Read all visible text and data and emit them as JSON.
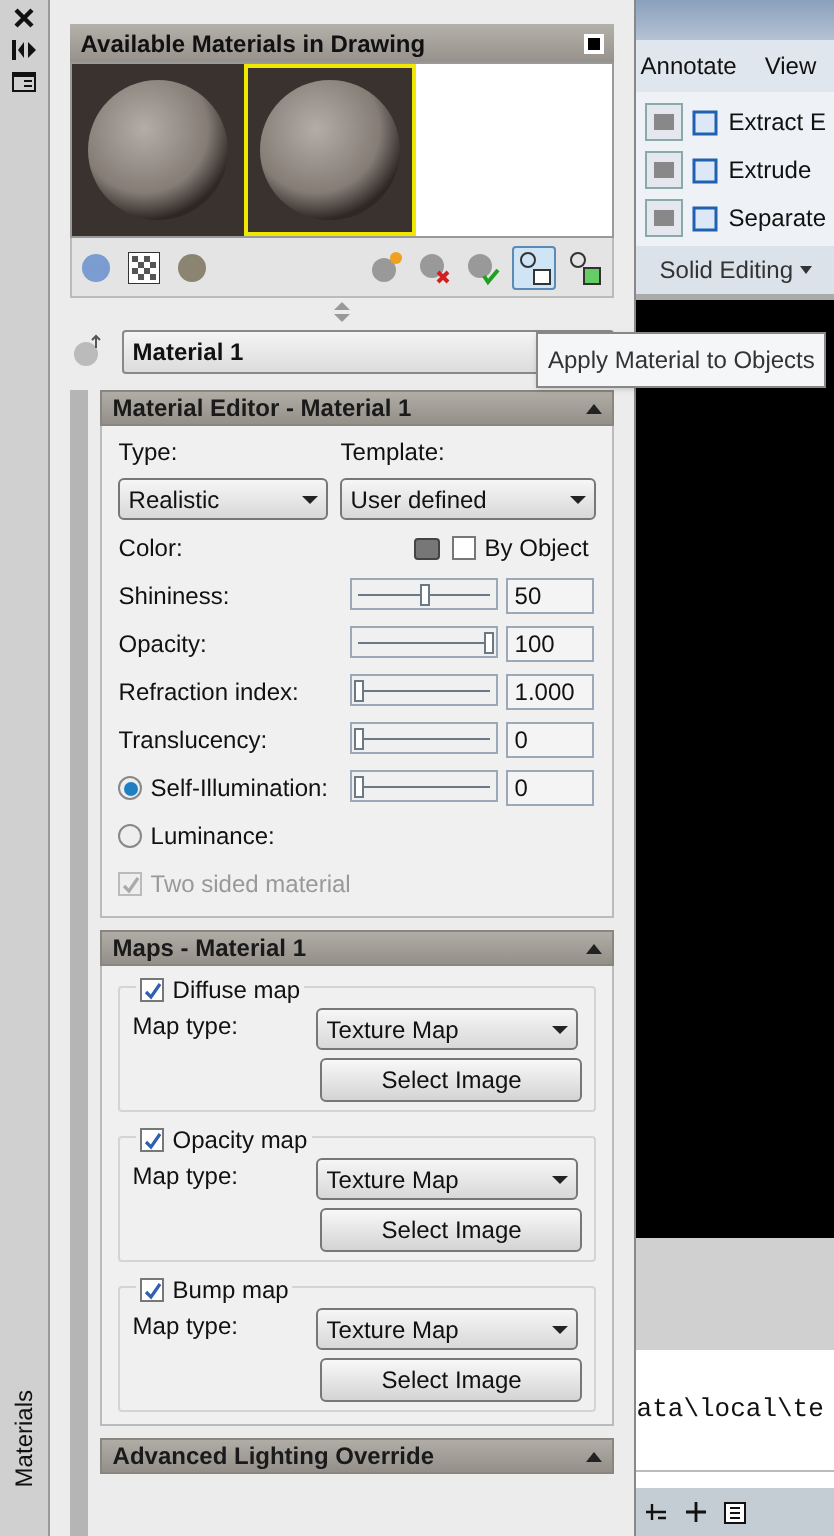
{
  "side_strip": {
    "label": "Materials"
  },
  "palette": {
    "title": "Available Materials in Drawing",
    "swatches": [
      {
        "selected": false
      },
      {
        "selected": true
      }
    ]
  },
  "material_name": "Material 1",
  "tooltip": "Apply Material to Objects",
  "material_editor": {
    "title": "Material Editor - Material 1",
    "type_label": "Type:",
    "type_value": "Realistic",
    "template_label": "Template:",
    "template_value": "User defined",
    "color_label": "Color:",
    "by_object": {
      "label": "By Object",
      "checked": false
    },
    "properties": [
      {
        "kind": "slider",
        "label": "Shininess:",
        "level": 0.5,
        "value": "50"
      },
      {
        "kind": "slider",
        "label": "Opacity:",
        "level": 1,
        "value": "100"
      },
      {
        "kind": "slider",
        "label": "Refraction index:",
        "level": 0,
        "value": "1.000"
      },
      {
        "kind": "slider",
        "label": "Translucency:",
        "level": 0,
        "value": "0"
      },
      {
        "kind": "radio-slider",
        "label": "Self-Illumination:",
        "selected": true,
        "level": 0,
        "value": "0"
      },
      {
        "kind": "radio",
        "label": "Luminance:",
        "selected": false
      }
    ],
    "two_sided": {
      "label": "Two sided material",
      "checked": true,
      "disabled": true
    }
  },
  "maps": {
    "title": "Maps - Material 1",
    "items": [
      {
        "label": "Diffuse map",
        "checked": true,
        "map_type_label": "Map type:",
        "map_type": "Texture Map",
        "button": "Select Image"
      },
      {
        "label": "Opacity map",
        "checked": true,
        "map_type_label": "Map type:",
        "map_type": "Texture Map",
        "button": "Select Image"
      },
      {
        "label": "Bump map",
        "checked": true,
        "map_type_label": "Map type:",
        "map_type": "Texture Map",
        "button": "Select Image"
      }
    ]
  },
  "advanced": {
    "title": "Advanced Lighting Override"
  },
  "ribbon": {
    "tabs": [
      "Annotate",
      "View"
    ],
    "tools": [
      "Extract E",
      "Extrude",
      "Separate"
    ],
    "panel_title": "Solid Editing"
  },
  "command_line": {
    "text": "ata\\local\\te"
  }
}
